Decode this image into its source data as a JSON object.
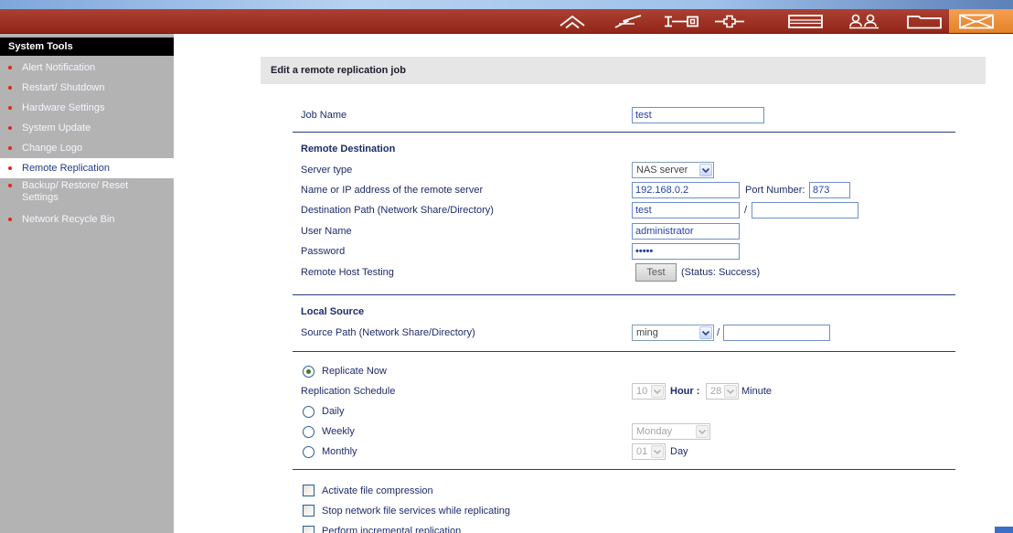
{
  "topbar": {
    "icons": [
      "home-icon",
      "flash-icon",
      "network-icon",
      "plus-icon",
      "panel-icon",
      "users-icon",
      "folder-icon",
      "mail-icon"
    ]
  },
  "sidebar": {
    "title": "System Tools",
    "items": [
      {
        "label": "Alert Notification",
        "selected": false
      },
      {
        "label": "Restart/ Shutdown",
        "selected": false
      },
      {
        "label": "Hardware Settings",
        "selected": false
      },
      {
        "label": "System Update",
        "selected": false
      },
      {
        "label": "Change Logo",
        "selected": false
      },
      {
        "label": "Remote Replication",
        "selected": true
      },
      {
        "label": "Backup/ Restore/ Reset Settings",
        "selected": false
      },
      {
        "label": "Network Recycle Bin",
        "selected": false
      }
    ]
  },
  "main": {
    "title": "Edit a remote replication job",
    "job_name": {
      "label": "Job Name",
      "value": "test"
    },
    "remote_destination": {
      "heading": "Remote Destination",
      "server_type": {
        "label": "Server type",
        "value": "NAS server"
      },
      "server_address": {
        "label": "Name or IP address of the remote server",
        "value": "192.168.0.2",
        "port_label": "Port Number:",
        "port_value": "873"
      },
      "destination_path": {
        "label": "Destination Path (Network Share/Directory)",
        "share": "test",
        "separator": "/",
        "directory": ""
      },
      "user_name": {
        "label": "User Name",
        "value": "administrator"
      },
      "password": {
        "label": "Password",
        "masked_value": "•••••"
      },
      "host_testing": {
        "label": "Remote Host Testing",
        "button": "Test",
        "status": "(Status: Success)"
      }
    },
    "local_source": {
      "heading": "Local Source",
      "source_path": {
        "label": "Source Path (Network Share/Directory)",
        "share": "ming",
        "separator": "/",
        "directory": ""
      }
    },
    "schedule": {
      "replicate_now": {
        "label": "Replicate Now",
        "selected": true
      },
      "label": "Replication Schedule",
      "hour": "10",
      "hour_label": "Hour :",
      "minute": "28",
      "minute_label": "Minute",
      "daily": {
        "label": "Daily",
        "selected": false
      },
      "weekly": {
        "label": "Weekly",
        "selected": false,
        "weekday": "Monday"
      },
      "monthly": {
        "label": "Monthly",
        "selected": false,
        "day": "01",
        "day_label": "Day"
      }
    },
    "options": [
      {
        "label": "Activate file compression",
        "checked": false
      },
      {
        "label": "Stop network file services while replicating",
        "checked": false
      },
      {
        "label": "Perform incremental replication",
        "checked": false
      }
    ]
  },
  "colors": {
    "top_strip": "#9fc1ea",
    "topbar": "#a22b1b",
    "topbar_active": "#f28a2c",
    "sidebar_bg": "#b3b3b3",
    "sidebar_header_bg": "#000000",
    "bullet": "#e3261b",
    "label_text": "#1d2b6b",
    "input_text": "#2443a8",
    "divider": "#2c3a7c",
    "header_bar": "#e6e6e6"
  }
}
